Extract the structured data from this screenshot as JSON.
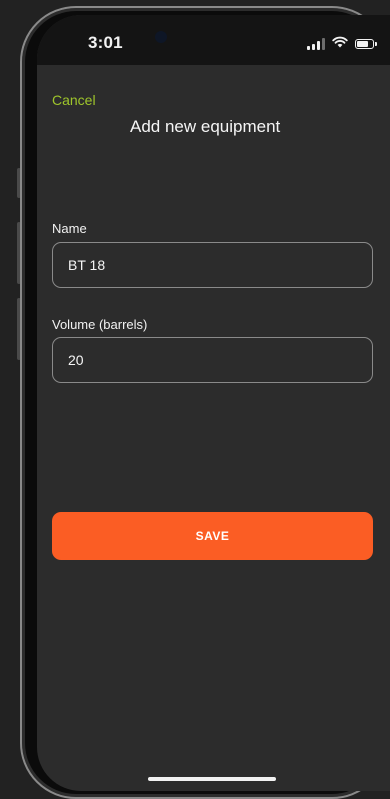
{
  "status_bar": {
    "time": "3:01",
    "icons": [
      "signal-icon",
      "wifi-icon",
      "battery-icon"
    ]
  },
  "nav": {
    "cancel_label": "Cancel",
    "title": "Add new equipment"
  },
  "form": {
    "name_label": "Name",
    "name_value": "BT 18",
    "volume_label": "Volume (barrels)",
    "volume_value": "20",
    "save_label": "SAVE"
  },
  "colors": {
    "accent_cancel": "#9ec52b",
    "save_button": "#fb5d24",
    "screen_background": "#2c2c2c"
  }
}
